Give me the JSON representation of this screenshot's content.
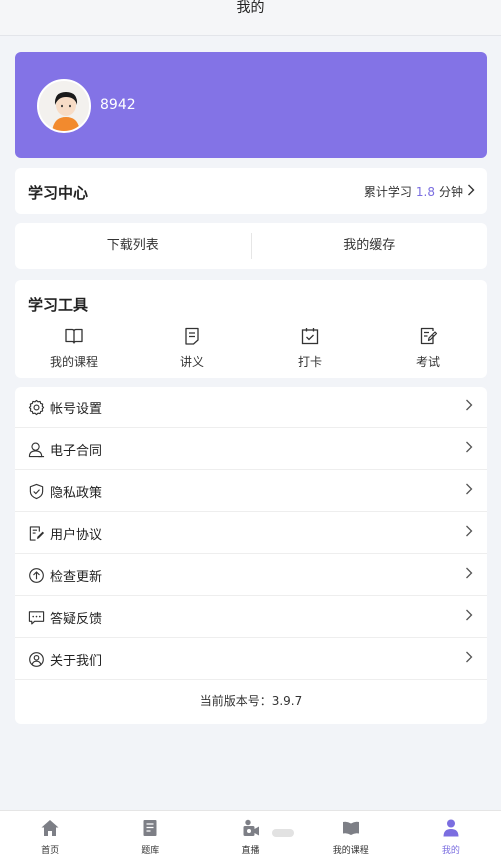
{
  "header": {
    "title": "我的"
  },
  "profile": {
    "username": "8942"
  },
  "learning_center": {
    "title": "学习中心",
    "stats_prefix": "累计学习",
    "stats_value": "1.8",
    "stats_unit": "分钟"
  },
  "downloads": {
    "left": "下载列表",
    "right": "我的缓存"
  },
  "tools": {
    "title": "学习工具",
    "items": [
      {
        "label": "我的课程",
        "icon": "book-icon"
      },
      {
        "label": "讲义",
        "icon": "document-icon"
      },
      {
        "label": "打卡",
        "icon": "calendar-check-icon"
      },
      {
        "label": "考试",
        "icon": "exam-icon"
      }
    ]
  },
  "menu": {
    "items": [
      {
        "label": "帐号设置",
        "icon": "gear-icon"
      },
      {
        "label": "电子合同",
        "icon": "person-icon"
      },
      {
        "label": "隐私政策",
        "icon": "shield-icon"
      },
      {
        "label": "用户协议",
        "icon": "agreement-icon"
      },
      {
        "label": "检查更新",
        "icon": "upload-icon"
      },
      {
        "label": "答疑反馈",
        "icon": "chat-icon"
      },
      {
        "label": "关于我们",
        "icon": "user-circle-icon"
      }
    ],
    "version": "当前版本号：3.9.7"
  },
  "tabbar": {
    "items": [
      {
        "label": "首页",
        "icon": "home-icon"
      },
      {
        "label": "题库",
        "icon": "question-bank-icon"
      },
      {
        "label": "直播",
        "icon": "live-icon"
      },
      {
        "label": "我的课程",
        "icon": "book-icon"
      },
      {
        "label": "我的",
        "icon": "user-icon"
      }
    ],
    "active_index": 4
  },
  "colors": {
    "accent": "#8373e6",
    "background": "#f2f4f8"
  }
}
